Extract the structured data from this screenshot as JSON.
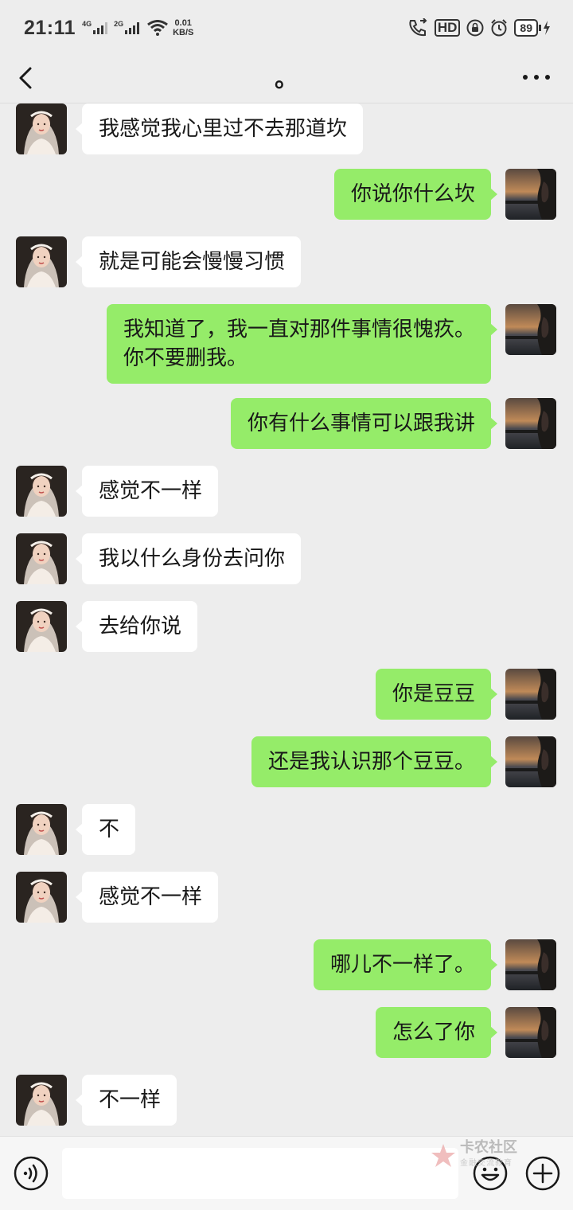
{
  "status_bar": {
    "time": "21:11",
    "sim1": "4G",
    "sim2": "2G",
    "speed_value": "0.01",
    "speed_unit": "KB/S",
    "hd_label": "HD",
    "battery": "89"
  },
  "nav": {
    "title": "。",
    "more_label": "···"
  },
  "messages": [
    {
      "side": "left",
      "text": "我感觉我心里过不去那道坎"
    },
    {
      "side": "right",
      "text": "你说你什么坎"
    },
    {
      "side": "left",
      "text": "就是可能会慢慢习惯"
    },
    {
      "side": "right",
      "text": "我知道了，我一直对那件事情很愧疚。\n你不要删我。"
    },
    {
      "side": "right",
      "text": "你有什么事情可以跟我讲"
    },
    {
      "side": "left",
      "text": "感觉不一样"
    },
    {
      "side": "left",
      "text": "我以什么身份去问你"
    },
    {
      "side": "left",
      "text": "去给你说"
    },
    {
      "side": "right",
      "text": "你是豆豆"
    },
    {
      "side": "right",
      "text": "还是我认识那个豆豆。"
    },
    {
      "side": "left",
      "text": "不"
    },
    {
      "side": "left",
      "text": "感觉不一样"
    },
    {
      "side": "right",
      "text": "哪儿不一样了。"
    },
    {
      "side": "right",
      "text": "怎么了你"
    },
    {
      "side": "left",
      "text": "不一样"
    }
  ],
  "input_bar": {
    "input_value": ""
  },
  "watermark": {
    "title": "卡农社区",
    "subtitle": "金融交流教育"
  },
  "colors": {
    "sent_bubble": "#95ec69",
    "received_bubble": "#ffffff",
    "background": "#ededed"
  }
}
